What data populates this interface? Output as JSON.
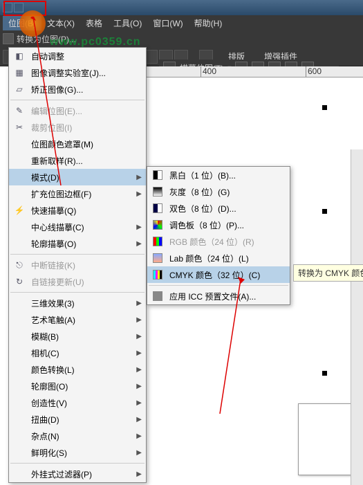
{
  "titlebar": {},
  "menubar": {
    "items": [
      "位图(B)",
      "文本(X)",
      "表格",
      "工具(O)",
      "窗口(W)",
      "帮助(H)"
    ]
  },
  "toolbar1": {
    "label": "转换为位图(P)..."
  },
  "toolbar2": {
    "btn1": "排版",
    "btn2": "增强插件"
  },
  "watermark": "www.pc0359.cn",
  "docbar": {
    "label": "描摹位图(T)"
  },
  "ruler": {
    "t1": "400",
    "t2": "600"
  },
  "menu_main": [
    {
      "label": "自动调整",
      "ic": "adj"
    },
    {
      "label": "图像调整实验室(J)...",
      "ic": "lab"
    },
    {
      "label": "矫正图像(G)...",
      "ic": "str"
    },
    {
      "sep": true
    },
    {
      "label": "编辑位图(E)...",
      "ic": "edit",
      "dis": true
    },
    {
      "label": "裁剪位图(I)",
      "ic": "crop",
      "dis": true
    },
    {
      "label": "位图颜色遮罩(M)",
      "ic": ""
    },
    {
      "label": "重新取样(R)...",
      "ic": ""
    },
    {
      "label": "模式(D)",
      "ic": "",
      "arr": true,
      "sel": true
    },
    {
      "label": "扩充位图边框(F)",
      "ic": "",
      "arr": true
    },
    {
      "label": "快速描摹(Q)",
      "ic": "qt"
    },
    {
      "label": "中心线描摹(C)",
      "ic": "",
      "arr": true
    },
    {
      "label": "轮廓描摹(O)",
      "ic": "",
      "arr": true
    },
    {
      "sep": true
    },
    {
      "label": "中断链接(K)",
      "ic": "brk",
      "dis": true
    },
    {
      "label": "自链接更新(U)",
      "ic": "upd",
      "dis": true
    },
    {
      "sep": true
    },
    {
      "label": "三维效果(3)",
      "ic": "",
      "arr": true
    },
    {
      "label": "艺术笔触(A)",
      "ic": "",
      "arr": true
    },
    {
      "label": "模糊(B)",
      "ic": "",
      "arr": true
    },
    {
      "label": "相机(C)",
      "ic": "",
      "arr": true
    },
    {
      "label": "颜色转换(L)",
      "ic": "",
      "arr": true
    },
    {
      "label": "轮廓图(O)",
      "ic": "",
      "arr": true
    },
    {
      "label": "创造性(V)",
      "ic": "",
      "arr": true
    },
    {
      "label": "扭曲(D)",
      "ic": "",
      "arr": true
    },
    {
      "label": "杂点(N)",
      "ic": "",
      "arr": true
    },
    {
      "label": "鲜明化(S)",
      "ic": "",
      "arr": true
    },
    {
      "sep": true
    },
    {
      "label": "外挂式过滤器(P)",
      "ic": "",
      "arr": true
    }
  ],
  "menu_sub": [
    {
      "label": "黑白（1 位）(B)...",
      "sw": "bw"
    },
    {
      "label": "灰度（8 位）(G)",
      "sw": "gray"
    },
    {
      "label": "双色（8 位）(D)...",
      "sw": "duo"
    },
    {
      "label": "调色板（8 位）(P)...",
      "sw": "pal"
    },
    {
      "label": "RGB 颜色（24 位）(R)",
      "sw": "rgb",
      "dis": true
    },
    {
      "label": "Lab 颜色（24 位）(L)",
      "sw": "lab"
    },
    {
      "label": "CMYK 颜色（32 位）(C)",
      "sw": "cmyk",
      "sel": true
    },
    {
      "sep": true
    },
    {
      "label": "应用 ICC 预置文件(A)...",
      "sw": "icc"
    }
  ],
  "tooltip": "转换为 CMYK 颜色"
}
